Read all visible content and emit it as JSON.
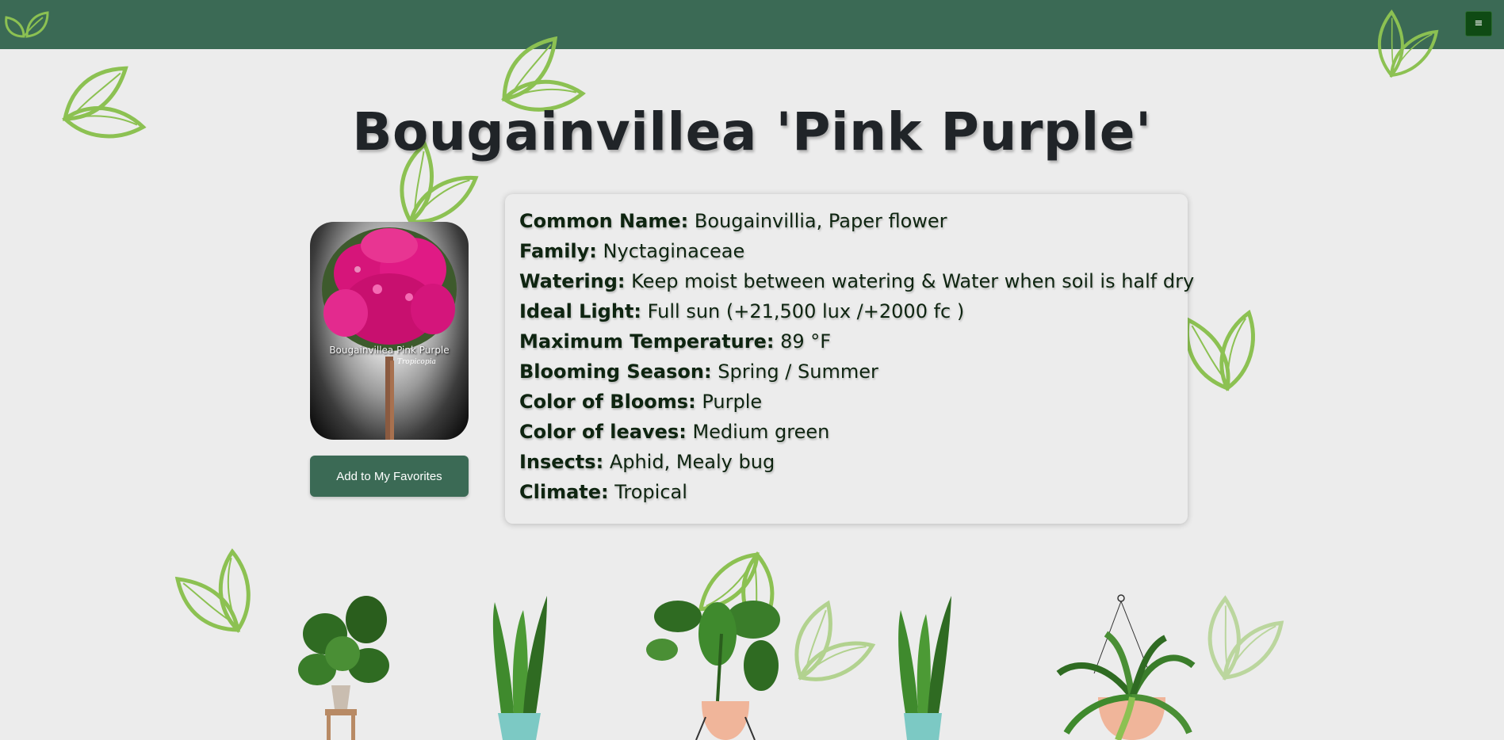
{
  "nav": {
    "logo_icon": "double-leaf-logo-icon",
    "menu_icon": "hamburger-menu-icon",
    "menu_label": "≡",
    "bg_color": "#3b6a55"
  },
  "page_title": "Bougainvillea 'Pink Purple'",
  "plant_image": {
    "caption": "Bougainvillea Pink Purple",
    "sub_caption": "Tropicopia"
  },
  "favorites_button": "Add to My Favorites",
  "details": [
    {
      "label": "Common Name:",
      "value": "Bougainvillia, Paper flower"
    },
    {
      "label": "Family:",
      "value": "Nyctaginaceae"
    },
    {
      "label": "Watering:",
      "value": "Keep moist between watering & Water when soil is half dry"
    },
    {
      "label": "Ideal Light:",
      "value": "Full sun (+21,500 lux /+2000 fc )"
    },
    {
      "label": "Maximum Temperature:",
      "value": "89 °F"
    },
    {
      "label": "Blooming Season:",
      "value": "Spring / Summer"
    },
    {
      "label": "Color of Blooms:",
      "value": "Purple"
    },
    {
      "label": "Color of leaves:",
      "value": "Medium green"
    },
    {
      "label": "Insects:",
      "value": "Aphid, Mealy bug"
    },
    {
      "label": "Climate:",
      "value": "Tropical"
    }
  ],
  "colors": {
    "accent": "#3b6a55",
    "leaf": "#8cc152",
    "background": "#ececec"
  }
}
